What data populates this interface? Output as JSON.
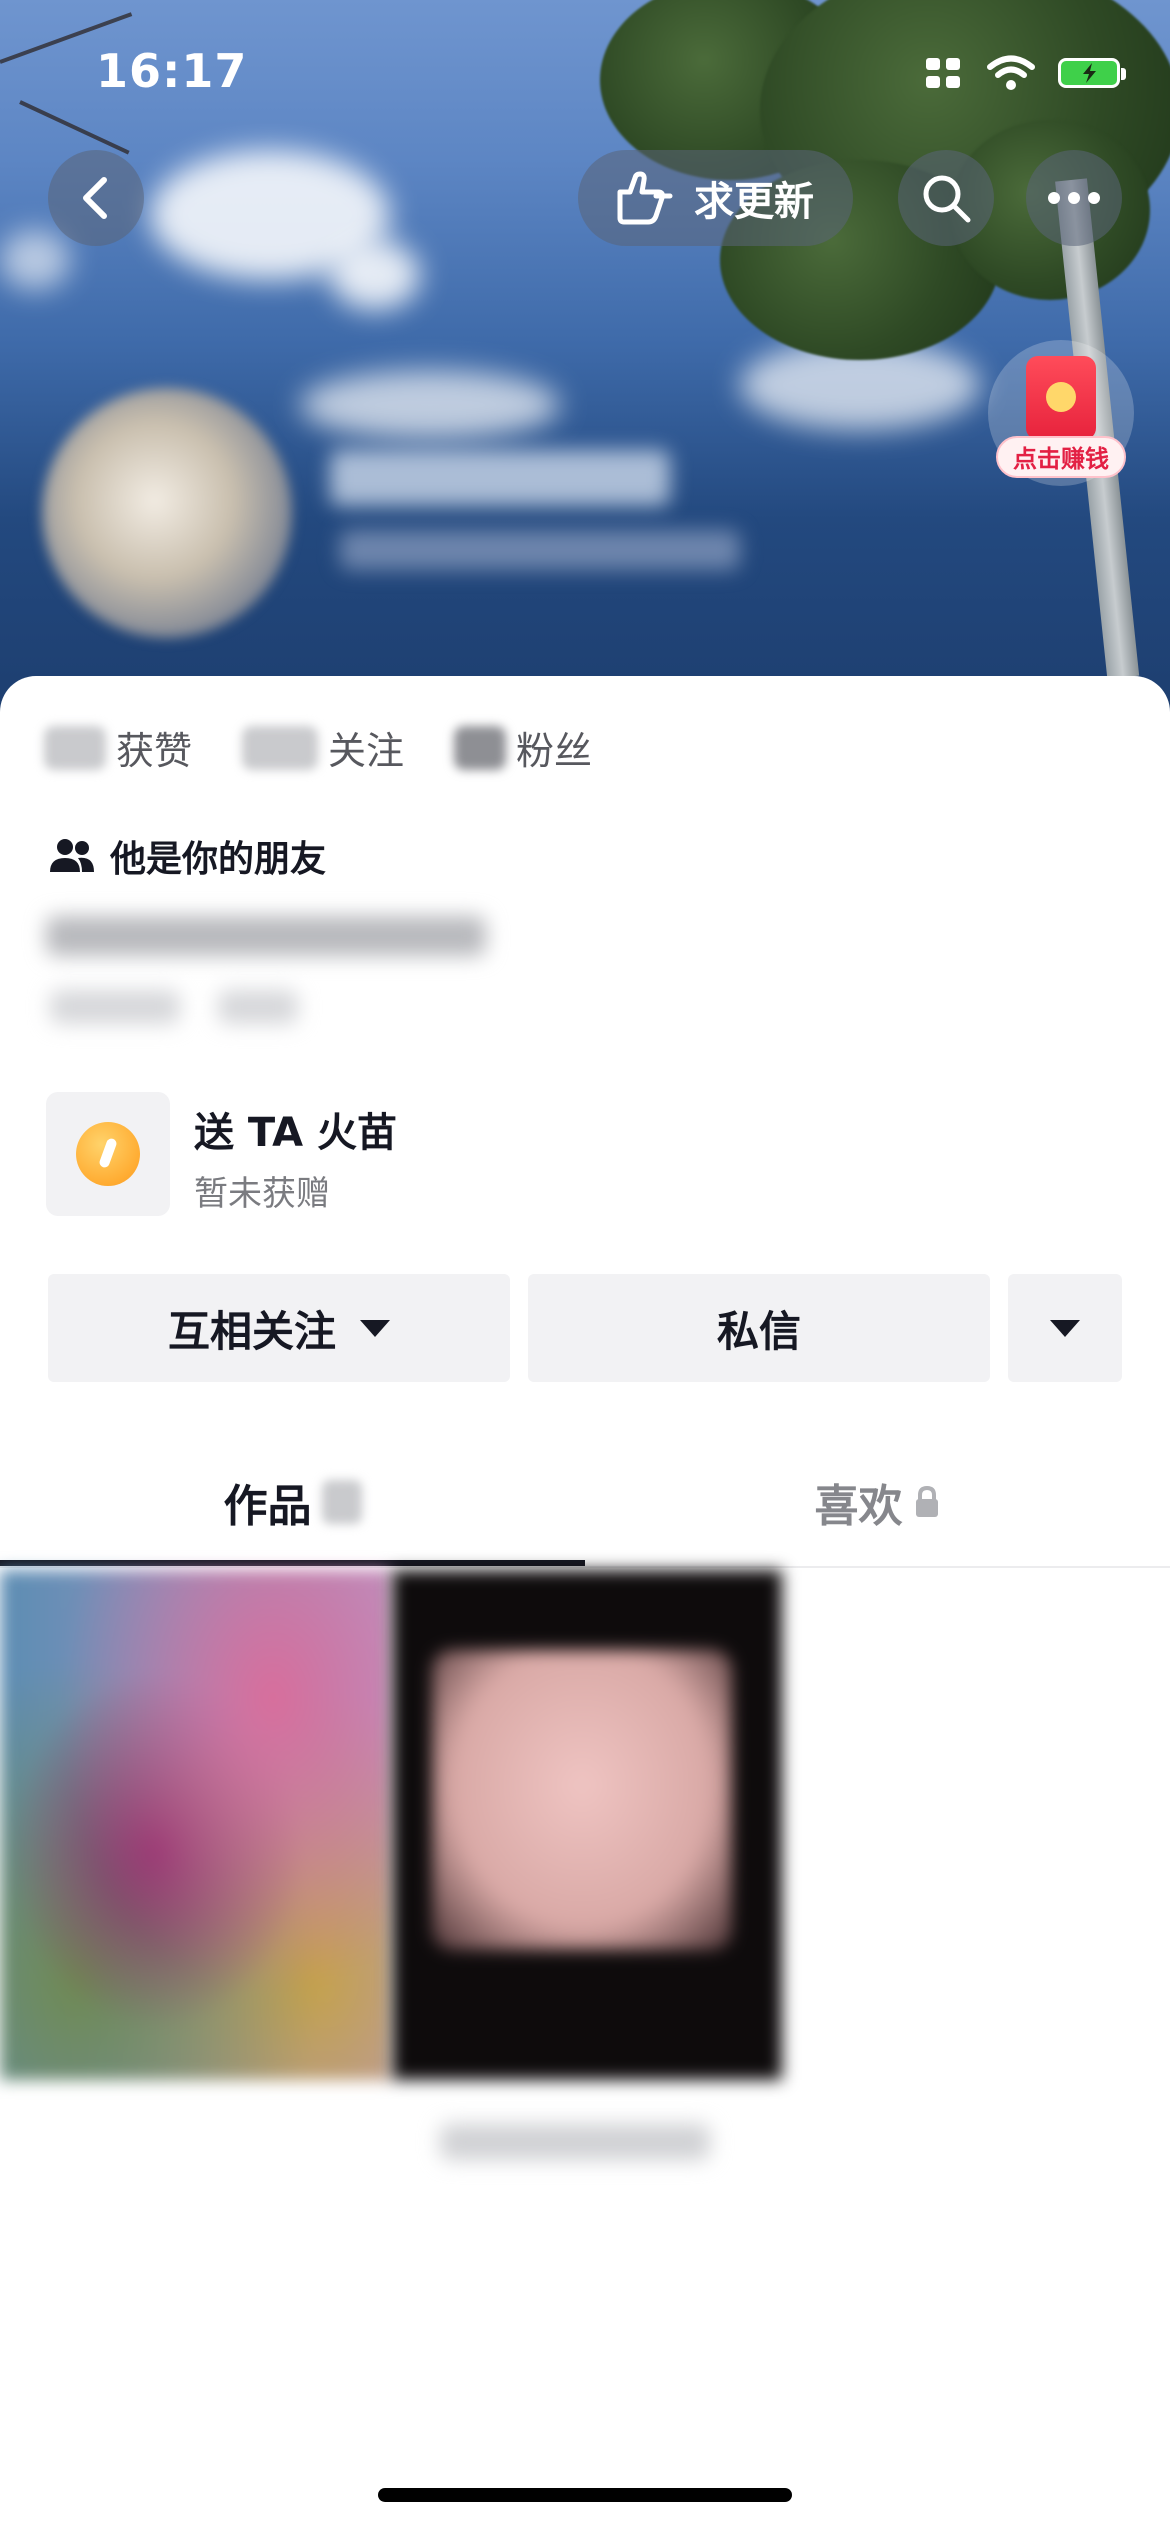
{
  "status_bar": {
    "time": "16:17"
  },
  "header": {
    "update_label": "求更新",
    "redpacket_label": "点击赚钱"
  },
  "stats": [
    {
      "label": "获赞"
    },
    {
      "label": "关注"
    },
    {
      "label": "粉丝"
    }
  ],
  "friend_badge": {
    "text": "他是你的朋友"
  },
  "gift": {
    "title": "送 TA 火苗",
    "subtitle": "暂未获赠"
  },
  "actions": {
    "follow_label": "互相关注",
    "message_label": "私信"
  },
  "tabs": [
    {
      "label": "作品",
      "active": true
    },
    {
      "label": "喜欢",
      "locked": true
    }
  ],
  "colors": {
    "accent_text": "#161823",
    "secondary_text": "#7a7b80",
    "button_bg": "#f2f2f4",
    "battery_fill": "#3fd04a",
    "redpacket": "#e7223c"
  },
  "icons": [
    "back-icon",
    "hand-point-icon",
    "search-icon",
    "more-icon",
    "cellular-icon",
    "wifi-icon",
    "battery-icon",
    "friends-icon",
    "flame-icon",
    "chevron-down-icon",
    "lock-icon"
  ]
}
